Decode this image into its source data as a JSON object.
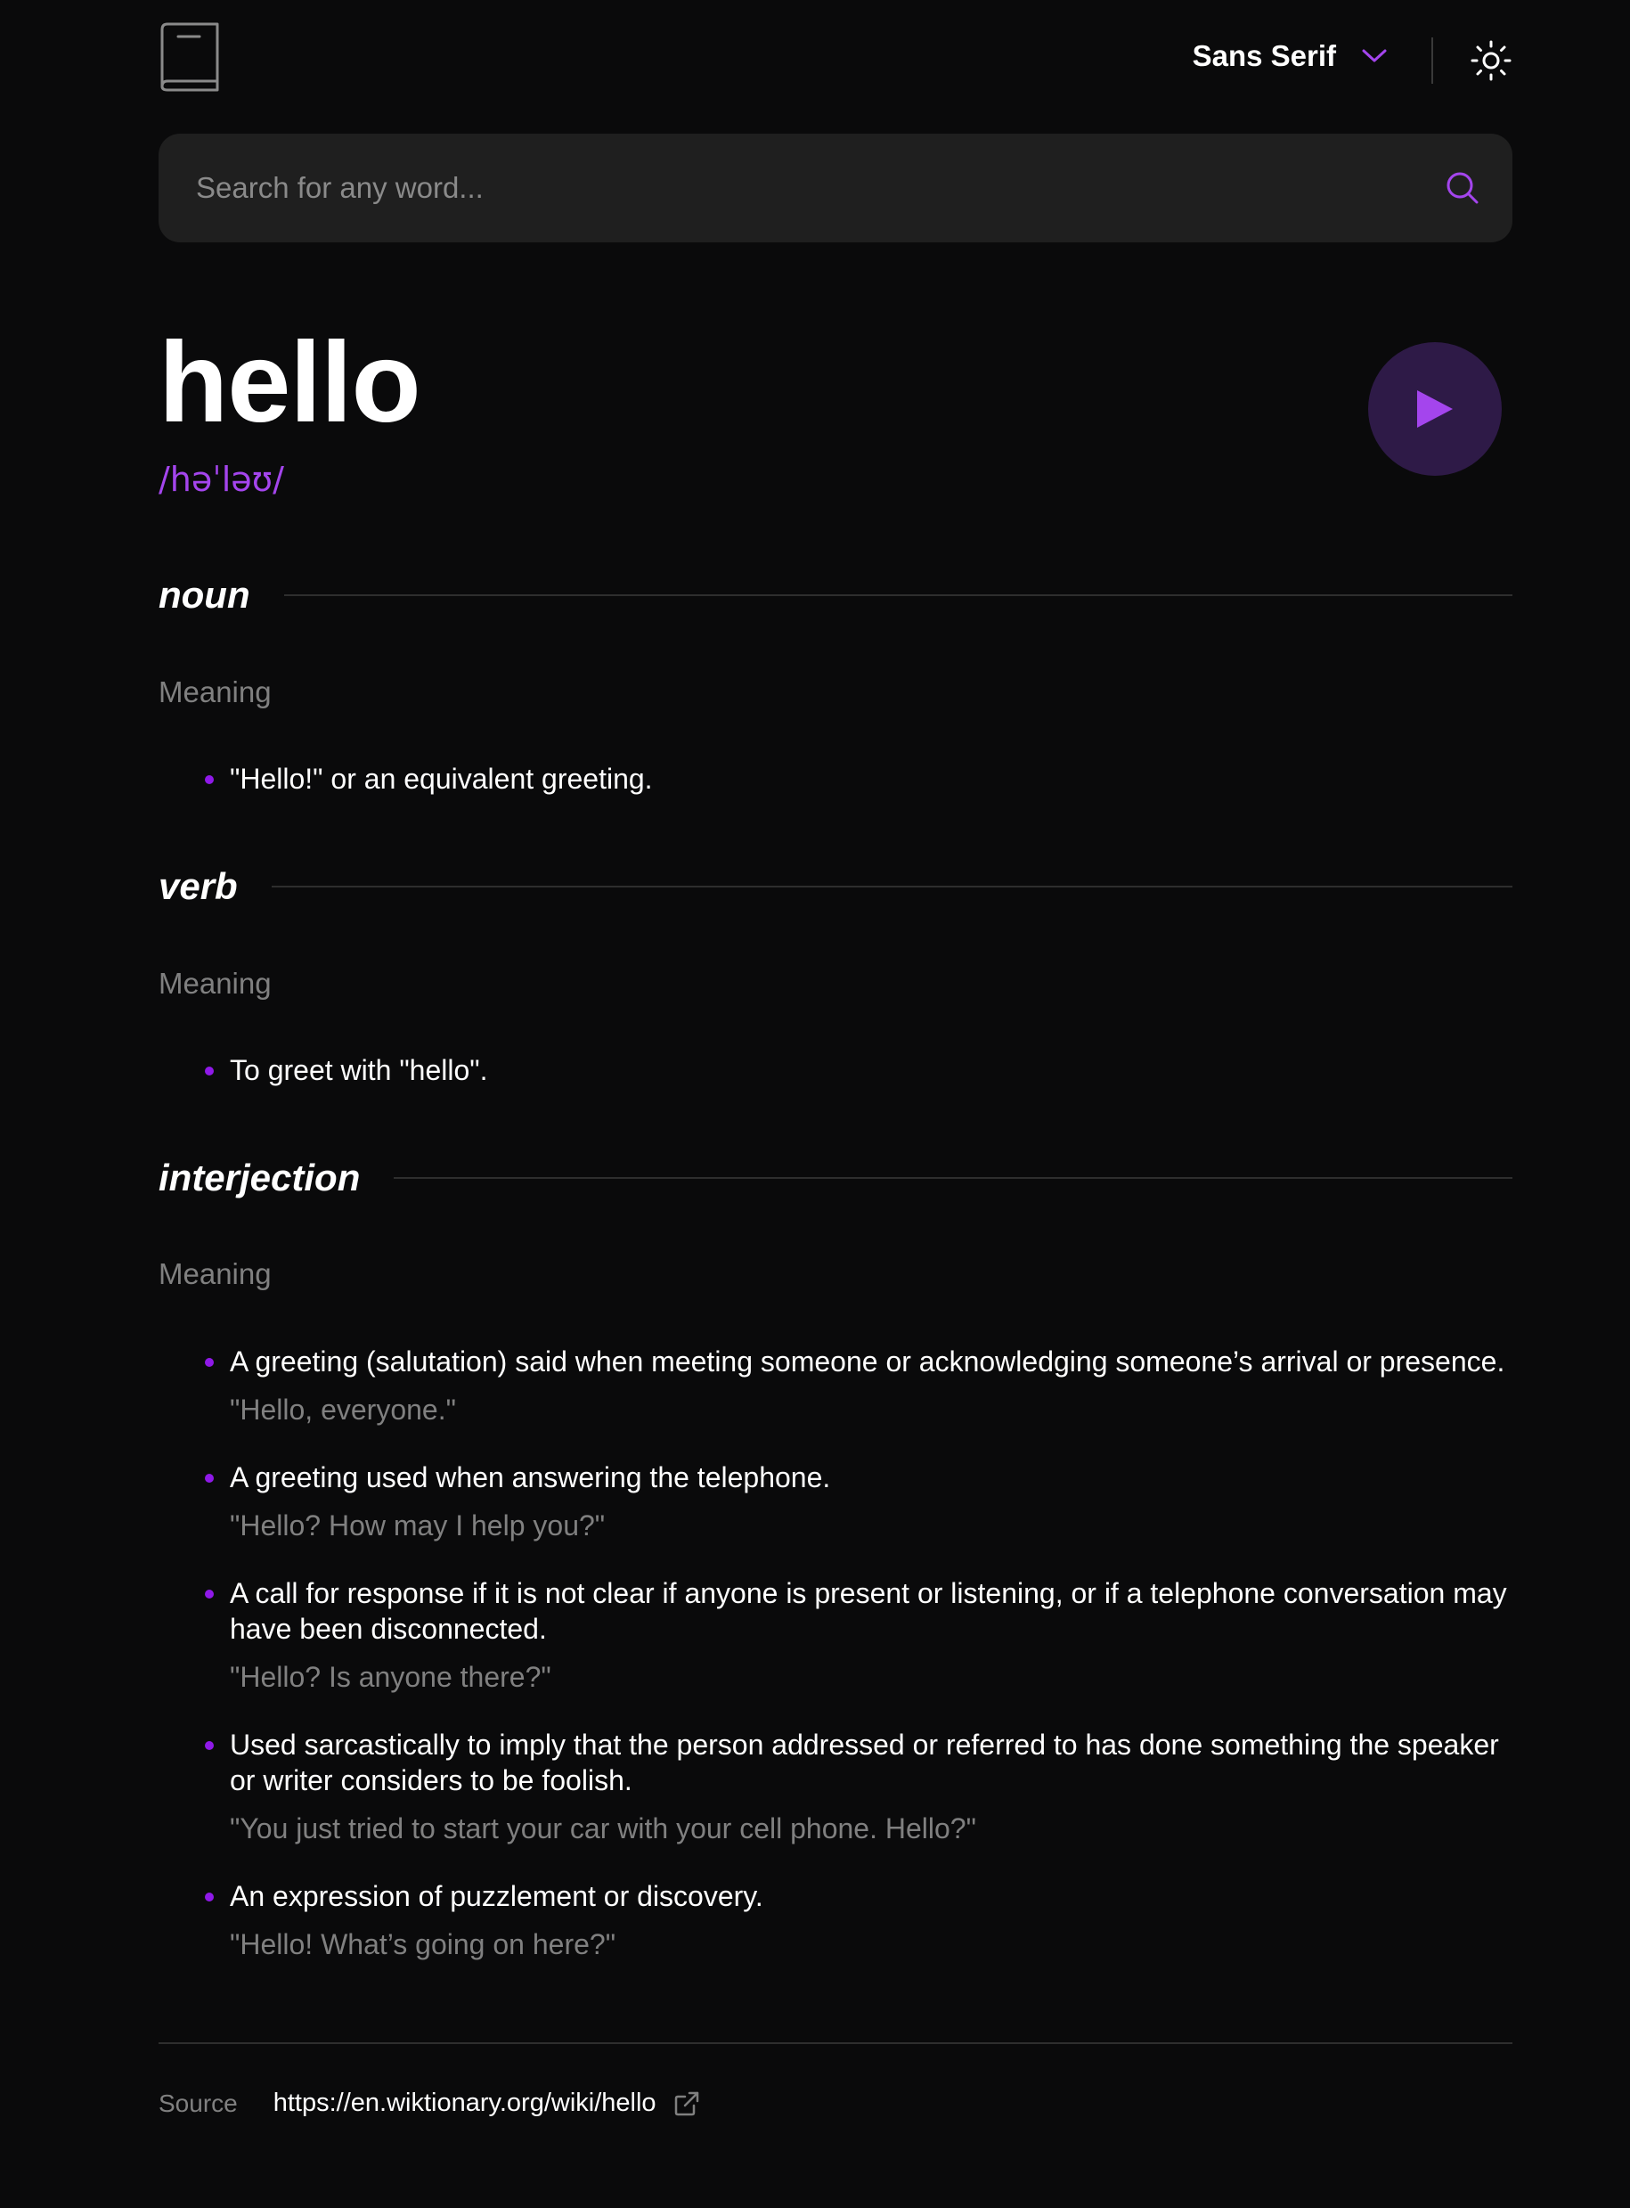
{
  "header": {
    "font_selector": {
      "label": "Sans Serif",
      "icon": "chevron-down-icon"
    },
    "theme_toggle": {
      "icon": "sun-icon"
    },
    "logo": {
      "icon": "book-icon"
    }
  },
  "search": {
    "placeholder": "Search for any word...",
    "value": "",
    "icon": "search-icon"
  },
  "entry": {
    "word": "hello",
    "phonetic": "/həˈləʊ/",
    "play_icon": "play-icon",
    "meanings": [
      {
        "part_of_speech": "noun",
        "meaning_label": "Meaning",
        "definitions": [
          {
            "text": "\"Hello!\" or an equivalent greeting.",
            "example": ""
          }
        ]
      },
      {
        "part_of_speech": "verb",
        "meaning_label": "Meaning",
        "definitions": [
          {
            "text": "To greet with \"hello\".",
            "example": ""
          }
        ]
      },
      {
        "part_of_speech": "interjection",
        "meaning_label": "Meaning",
        "definitions": [
          {
            "text": "A greeting (salutation) said when meeting someone or acknowledging someone’s arrival or presence.",
            "example": "\"Hello, everyone.\""
          },
          {
            "text": "A greeting used when answering the telephone.",
            "example": "\"Hello? How may I help you?\""
          },
          {
            "text": "A call for response if it is not clear if anyone is present or listening, or if a telephone conversation may have been disconnected.",
            "example": "\"Hello? Is anyone there?\""
          },
          {
            "text": "Used sarcastically to imply that the person addressed or referred to has done something the speaker or writer considers to be foolish.",
            "example": "\"You just tried to start your car with your cell phone. Hello?\""
          },
          {
            "text": "An expression of puzzlement or discovery.",
            "example": "\"Hello! What’s going on here?\""
          }
        ]
      }
    ]
  },
  "footer": {
    "source_label": "Source",
    "source_url": "https://en.wiktionary.org/wiki/hello",
    "external_icon": "external-link-icon"
  },
  "colors": {
    "accent": "#a445ed",
    "bullet": "#8f19e8",
    "background": "#0a0a0b",
    "search_bg": "#1f1f1f",
    "muted_text": "#808080",
    "divider": "#2e2e2e",
    "play_bg": "#2e1a47"
  }
}
